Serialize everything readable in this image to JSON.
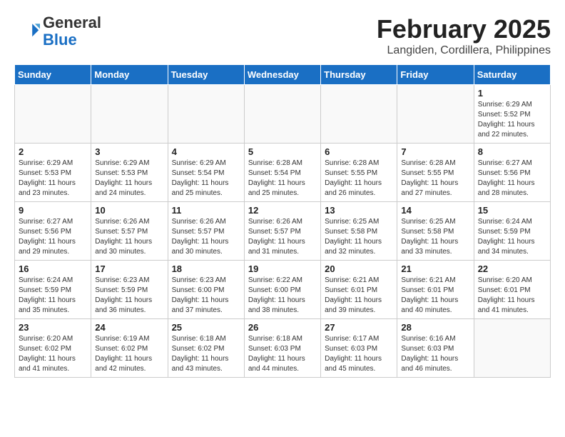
{
  "logo": {
    "text_general": "General",
    "text_blue": "Blue"
  },
  "header": {
    "title": "February 2025",
    "subtitle": "Langiden, Cordillera, Philippines"
  },
  "weekdays": [
    "Sunday",
    "Monday",
    "Tuesday",
    "Wednesday",
    "Thursday",
    "Friday",
    "Saturday"
  ],
  "weeks": [
    [
      {
        "day": "",
        "info": ""
      },
      {
        "day": "",
        "info": ""
      },
      {
        "day": "",
        "info": ""
      },
      {
        "day": "",
        "info": ""
      },
      {
        "day": "",
        "info": ""
      },
      {
        "day": "",
        "info": ""
      },
      {
        "day": "1",
        "info": "Sunrise: 6:29 AM\nSunset: 5:52 PM\nDaylight: 11 hours\nand 22 minutes."
      }
    ],
    [
      {
        "day": "2",
        "info": "Sunrise: 6:29 AM\nSunset: 5:53 PM\nDaylight: 11 hours\nand 23 minutes."
      },
      {
        "day": "3",
        "info": "Sunrise: 6:29 AM\nSunset: 5:53 PM\nDaylight: 11 hours\nand 24 minutes."
      },
      {
        "day": "4",
        "info": "Sunrise: 6:29 AM\nSunset: 5:54 PM\nDaylight: 11 hours\nand 25 minutes."
      },
      {
        "day": "5",
        "info": "Sunrise: 6:28 AM\nSunset: 5:54 PM\nDaylight: 11 hours\nand 25 minutes."
      },
      {
        "day": "6",
        "info": "Sunrise: 6:28 AM\nSunset: 5:55 PM\nDaylight: 11 hours\nand 26 minutes."
      },
      {
        "day": "7",
        "info": "Sunrise: 6:28 AM\nSunset: 5:55 PM\nDaylight: 11 hours\nand 27 minutes."
      },
      {
        "day": "8",
        "info": "Sunrise: 6:27 AM\nSunset: 5:56 PM\nDaylight: 11 hours\nand 28 minutes."
      }
    ],
    [
      {
        "day": "9",
        "info": "Sunrise: 6:27 AM\nSunset: 5:56 PM\nDaylight: 11 hours\nand 29 minutes."
      },
      {
        "day": "10",
        "info": "Sunrise: 6:26 AM\nSunset: 5:57 PM\nDaylight: 11 hours\nand 30 minutes."
      },
      {
        "day": "11",
        "info": "Sunrise: 6:26 AM\nSunset: 5:57 PM\nDaylight: 11 hours\nand 30 minutes."
      },
      {
        "day": "12",
        "info": "Sunrise: 6:26 AM\nSunset: 5:57 PM\nDaylight: 11 hours\nand 31 minutes."
      },
      {
        "day": "13",
        "info": "Sunrise: 6:25 AM\nSunset: 5:58 PM\nDaylight: 11 hours\nand 32 minutes."
      },
      {
        "day": "14",
        "info": "Sunrise: 6:25 AM\nSunset: 5:58 PM\nDaylight: 11 hours\nand 33 minutes."
      },
      {
        "day": "15",
        "info": "Sunrise: 6:24 AM\nSunset: 5:59 PM\nDaylight: 11 hours\nand 34 minutes."
      }
    ],
    [
      {
        "day": "16",
        "info": "Sunrise: 6:24 AM\nSunset: 5:59 PM\nDaylight: 11 hours\nand 35 minutes."
      },
      {
        "day": "17",
        "info": "Sunrise: 6:23 AM\nSunset: 5:59 PM\nDaylight: 11 hours\nand 36 minutes."
      },
      {
        "day": "18",
        "info": "Sunrise: 6:23 AM\nSunset: 6:00 PM\nDaylight: 11 hours\nand 37 minutes."
      },
      {
        "day": "19",
        "info": "Sunrise: 6:22 AM\nSunset: 6:00 PM\nDaylight: 11 hours\nand 38 minutes."
      },
      {
        "day": "20",
        "info": "Sunrise: 6:21 AM\nSunset: 6:01 PM\nDaylight: 11 hours\nand 39 minutes."
      },
      {
        "day": "21",
        "info": "Sunrise: 6:21 AM\nSunset: 6:01 PM\nDaylight: 11 hours\nand 40 minutes."
      },
      {
        "day": "22",
        "info": "Sunrise: 6:20 AM\nSunset: 6:01 PM\nDaylight: 11 hours\nand 41 minutes."
      }
    ],
    [
      {
        "day": "23",
        "info": "Sunrise: 6:20 AM\nSunset: 6:02 PM\nDaylight: 11 hours\nand 41 minutes."
      },
      {
        "day": "24",
        "info": "Sunrise: 6:19 AM\nSunset: 6:02 PM\nDaylight: 11 hours\nand 42 minutes."
      },
      {
        "day": "25",
        "info": "Sunrise: 6:18 AM\nSunset: 6:02 PM\nDaylight: 11 hours\nand 43 minutes."
      },
      {
        "day": "26",
        "info": "Sunrise: 6:18 AM\nSunset: 6:03 PM\nDaylight: 11 hours\nand 44 minutes."
      },
      {
        "day": "27",
        "info": "Sunrise: 6:17 AM\nSunset: 6:03 PM\nDaylight: 11 hours\nand 45 minutes."
      },
      {
        "day": "28",
        "info": "Sunrise: 6:16 AM\nSunset: 6:03 PM\nDaylight: 11 hours\nand 46 minutes."
      },
      {
        "day": "",
        "info": ""
      }
    ]
  ]
}
